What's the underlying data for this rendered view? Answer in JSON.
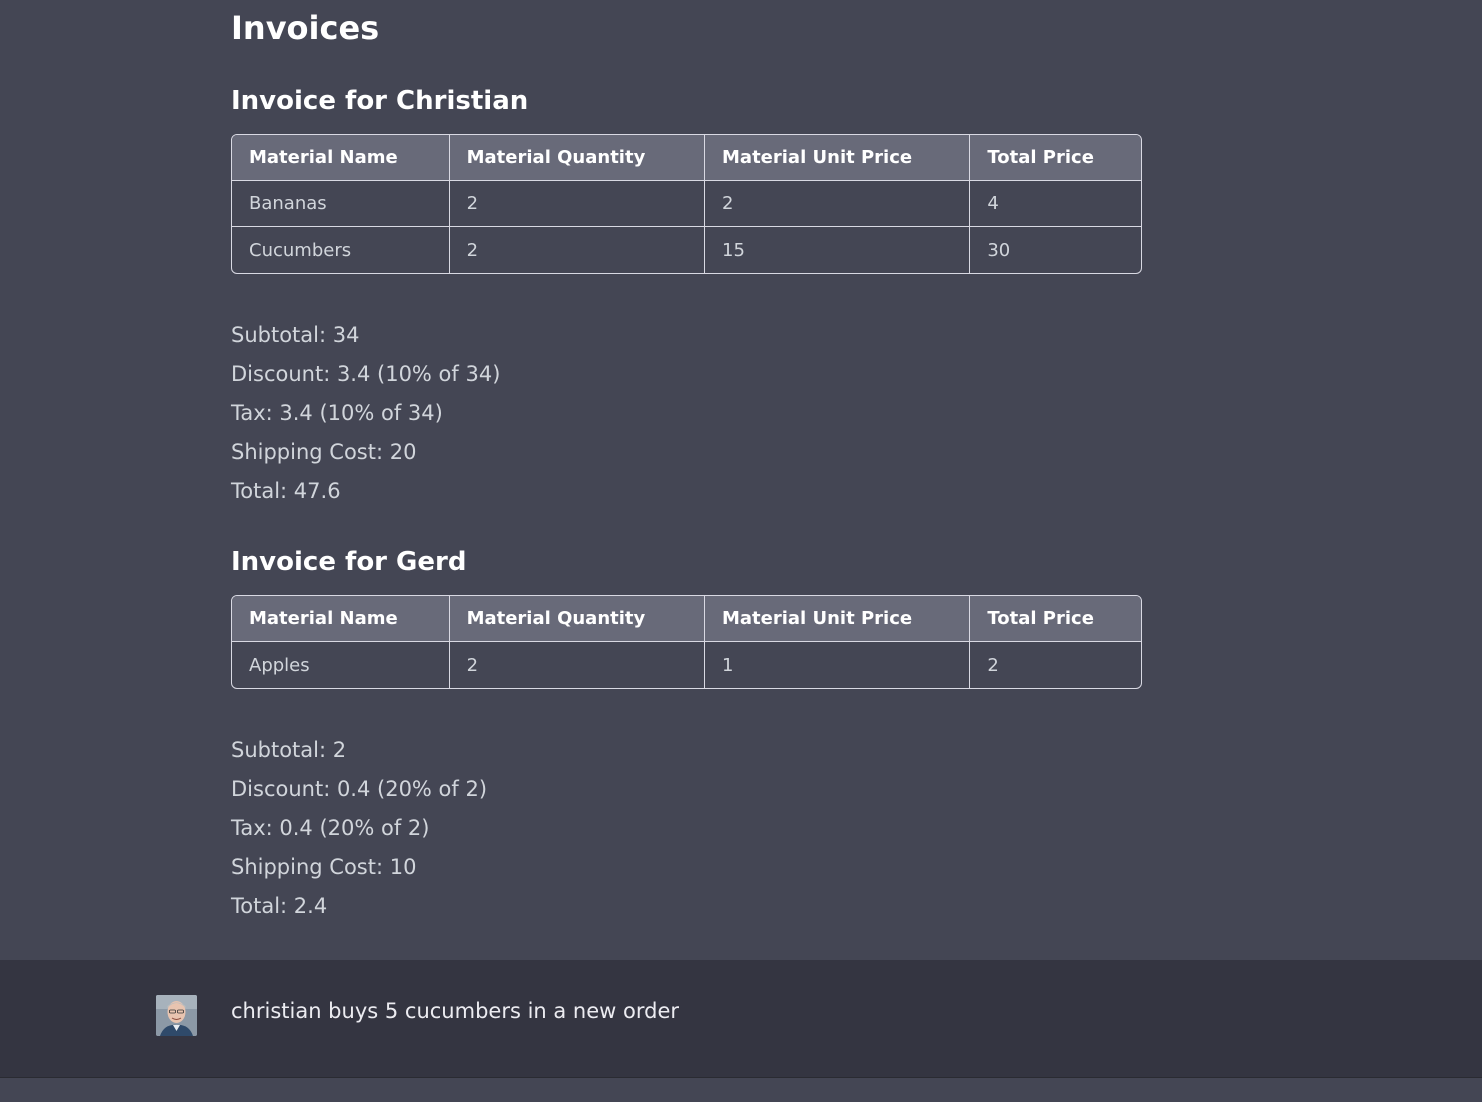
{
  "page": {
    "title": "Invoices"
  },
  "table_headers": [
    "Material Name",
    "Material Quantity",
    "Material Unit Price",
    "Total Price"
  ],
  "invoices": [
    {
      "title": "Invoice for Christian",
      "rows": [
        [
          "Bananas",
          "2",
          "2",
          "4"
        ],
        [
          "Cucumbers",
          "2",
          "15",
          "30"
        ]
      ],
      "summary": {
        "subtotal": "Subtotal: 34",
        "discount": "Discount: 3.4 (10% of 34)",
        "tax": "Tax: 3.4 (10% of 34)",
        "shipping": "Shipping Cost: 20",
        "total": "Total: 47.6"
      }
    },
    {
      "title": "Invoice for Gerd",
      "rows": [
        [
          "Apples",
          "2",
          "1",
          "2"
        ]
      ],
      "summary": {
        "subtotal": "Subtotal: 2",
        "discount": "Discount: 0.4 (20% of 2)",
        "tax": "Tax: 0.4 (20% of 2)",
        "shipping": "Shipping Cost: 10",
        "total": "Total: 2.4"
      }
    }
  ],
  "user_message": {
    "text": "christian buys 5 cucumbers in a new order"
  },
  "colors": {
    "assistant_bg": "#444654",
    "user_bg": "#343541",
    "table_header_bg": "#686a79",
    "text": "#d1d5db"
  }
}
